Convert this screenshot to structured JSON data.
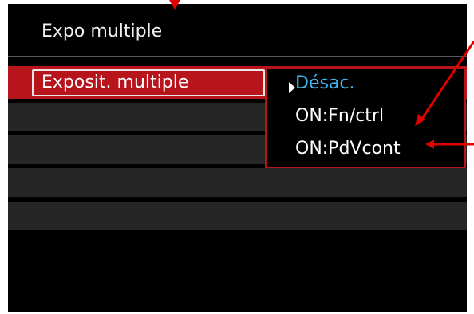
{
  "menu": {
    "title": "Expo multiple",
    "setting_label": "Exposit. multiple",
    "options": [
      {
        "label": "Désac.",
        "selected": true
      },
      {
        "label": "ON:Fn/ctrl",
        "selected": false
      },
      {
        "label": "ON:PdVcont",
        "selected": false
      }
    ]
  },
  "colors": {
    "highlight": "#b8141c",
    "selected_text": "#3fb6f0",
    "annotation": "#e00000"
  }
}
